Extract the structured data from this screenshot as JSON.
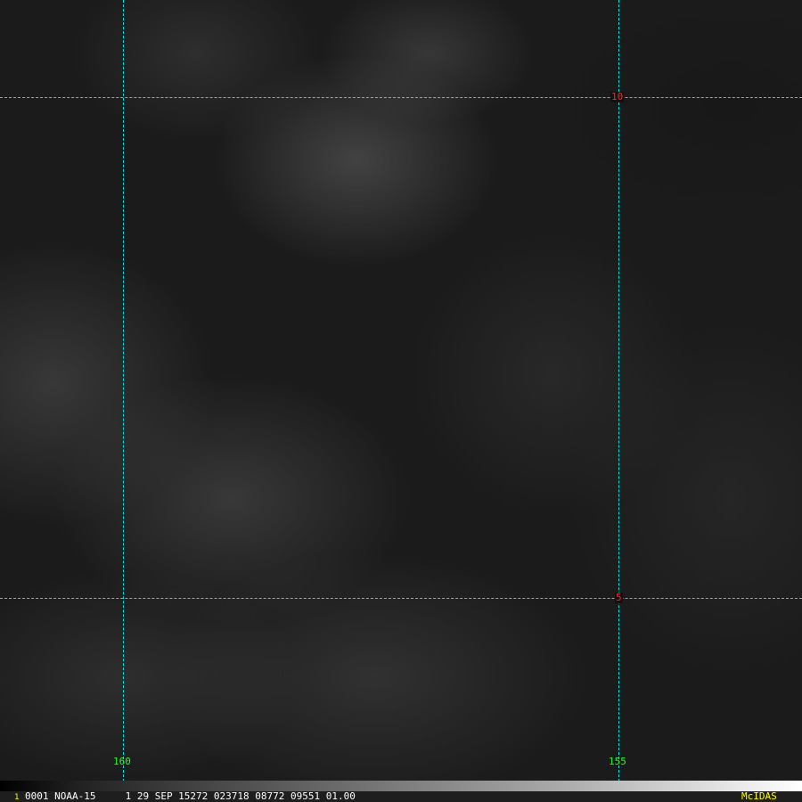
{
  "image": {
    "type": "satellite-visible",
    "colors": {
      "grid": "#00e5e5",
      "lat_label": "#ff2020",
      "lon_label": "#20ff20",
      "banner": "#ffff00"
    }
  },
  "grid": {
    "latitudes": [
      {
        "label": "10"
      },
      {
        "label": "5"
      }
    ],
    "longitudes": [
      {
        "label": "160"
      },
      {
        "label": "155"
      }
    ]
  },
  "infobar": {
    "frame": "1",
    "text": "0001 NOAA-15     1 29 SEP 15272 023718 08772 09551 01.00",
    "brand": "McIDAS"
  }
}
